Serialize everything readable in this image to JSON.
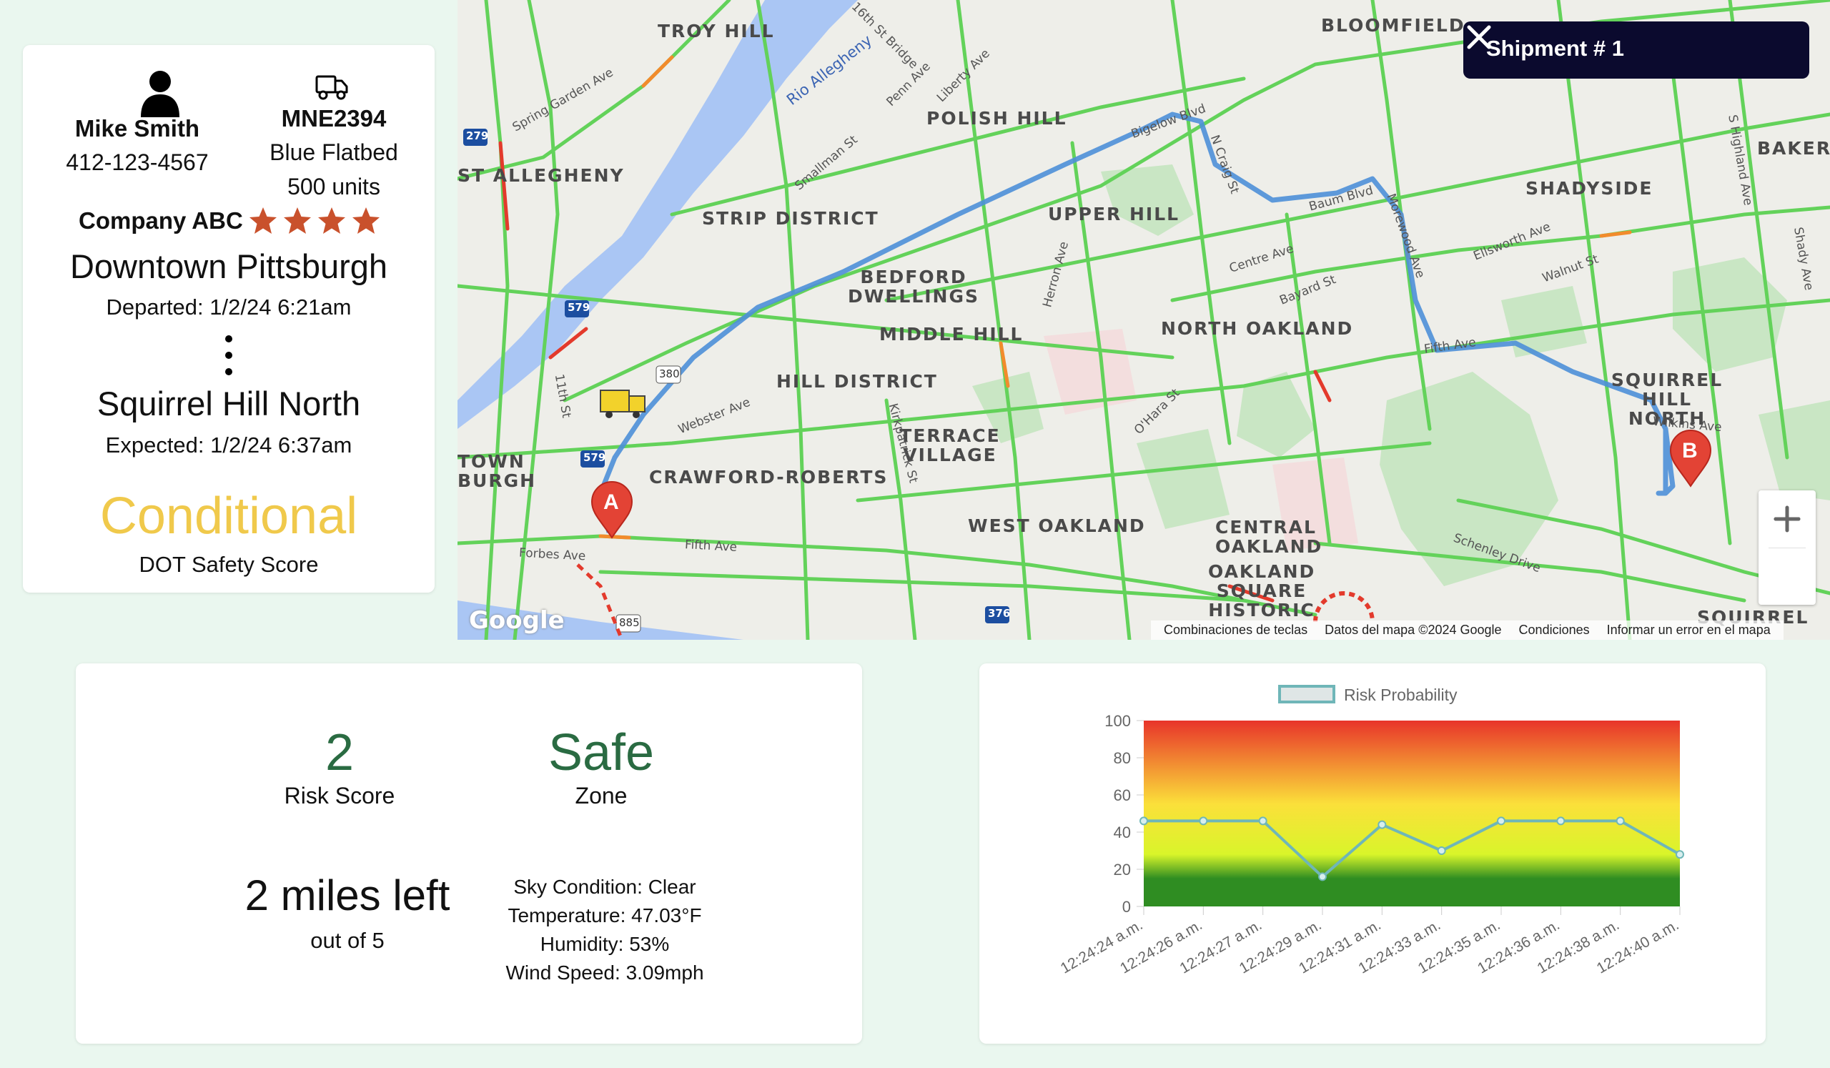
{
  "driver": {
    "name": "Mike Smith",
    "phone": "412-123-4567",
    "icon": "person-icon"
  },
  "truck": {
    "plate": "MNE2394",
    "description": "Blue Flatbed",
    "units": "500 units",
    "icon": "truck-icon"
  },
  "company": {
    "name": "Company ABC",
    "rating": 4,
    "star_color": "#c9512c"
  },
  "trip": {
    "origin": "Downtown Pittsburgh",
    "departed": "Departed: 1/2/24 6:21am",
    "destination": "Squirrel Hill North",
    "expected": "Expected: 1/2/24 6:37am"
  },
  "dot_safety": {
    "level": "Conditional",
    "label": "DOT Safety Score",
    "color": "#f0c94b"
  },
  "map": {
    "shipment_title": "Shipment # 1",
    "close_icon": "close-icon",
    "zoom_in_icon": "plus-icon",
    "zoom_out_icon": "minus-icon",
    "marker_a": "A",
    "marker_b": "B",
    "google_logo": "Google",
    "footer": [
      "Combinaciones de teclas",
      "Datos del mapa ©2024 Google",
      "Condiciones",
      "Informar un error en el mapa"
    ],
    "neighborhoods": [
      "TROY HILL",
      "BLOOMFIELD",
      "POLISH HILL",
      "BAKERY",
      "ST ALLEGHENY",
      "SHADYSIDE",
      "STRIP DISTRICT",
      "UPPER HILL",
      "BEDFORD DWELLINGS",
      "NORTH OAKLAND",
      "MIDDLE HILL",
      "HILL DISTRICT",
      "SQUIRREL HILL NORTH",
      "TERRACE VILLAGE",
      "TOWN BURGH",
      "CRAWFORD-ROBERTS",
      "WEST OAKLAND",
      "CENTRAL OAKLAND",
      "OAKLAND SQUARE HISTORIC",
      "SQUIRREL"
    ],
    "streets": [
      "Spring Garden Ave",
      "Rio Allegheny",
      "Penn Ave",
      "Liberty Ave",
      "Smallman St",
      "Bigelow Blvd",
      "N Craig St",
      "Baum Blvd",
      "Morewood Ave",
      "Centre Ave",
      "Bayard St",
      "Ellsworth Ave",
      "Walnut St",
      "S Highland Ave",
      "Shady Ave",
      "Fifth Ave",
      "Wilkins Ave",
      "Schenley Drive",
      "Forbes Ave",
      "Webster Ave",
      "Kirkpatrick St",
      "O'Hara St",
      "Herron Ave",
      "16th St Bridge",
      "11th St"
    ],
    "highway_shields": [
      "279",
      "579",
      "380",
      "579",
      "376",
      "885"
    ]
  },
  "risk": {
    "score": "2",
    "score_label": "Risk Score",
    "zone": "Safe",
    "zone_label": "Zone",
    "miles_left": "2 miles left",
    "miles_total": "out of 5",
    "sky": "Sky Condition: Clear",
    "temperature": "Temperature: 47.03°F",
    "humidity": "Humidity: 53%",
    "wind": "Wind Speed: 3.09mph",
    "value_color": "#2a6b42"
  },
  "chart_data": {
    "type": "line",
    "title": "",
    "xlabel": "",
    "ylabel": "",
    "ylim": [
      0,
      100
    ],
    "yticks": [
      0,
      20,
      40,
      60,
      80,
      100
    ],
    "categories": [
      "12:24:24 a.m.",
      "12:24:26 a.m.",
      "12:24:27 a.m.",
      "12:24:29 a.m.",
      "12:24:31 a.m.",
      "12:24:33 a.m.",
      "12:24:35 a.m.",
      "12:24:36 a.m.",
      "12:24:38 a.m.",
      "12:24:40 a.m."
    ],
    "series": [
      {
        "name": "Risk Probability",
        "values": [
          46,
          46,
          46,
          16,
          44,
          30,
          46,
          46,
          46,
          28
        ],
        "color": "#6fb6b8"
      }
    ],
    "legend": "top",
    "background_gradient": [
      "#e8342a",
      "#fbe03a",
      "#d9f52a",
      "#2f8d22"
    ]
  }
}
